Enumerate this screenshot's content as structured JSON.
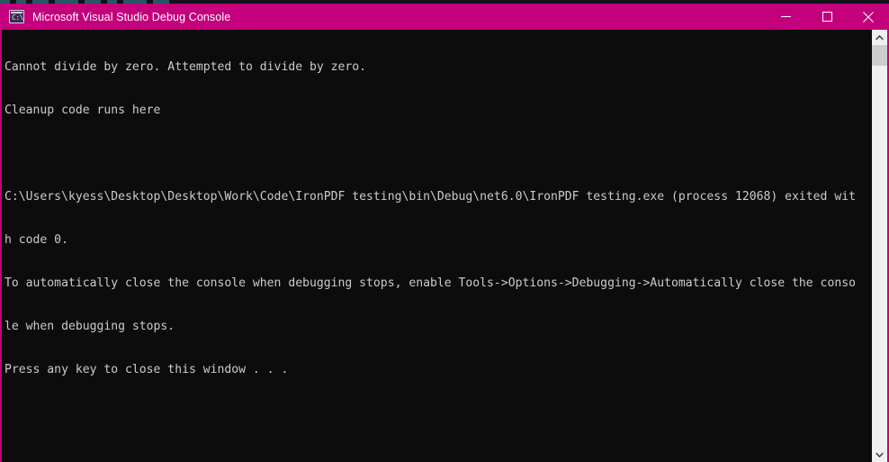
{
  "window": {
    "title": "Microsoft Visual Studio Debug Console",
    "icon": "console-window-icon",
    "icon_glyph": "C:\\",
    "titlebar_color": "#c5007c",
    "body_color": "#0c0c0c",
    "text_color": "#cccccc"
  },
  "titlebar_buttons": {
    "minimize": "minimize-icon",
    "maximize": "maximize-icon",
    "close": "close-icon"
  },
  "console": {
    "lines": [
      "Cannot divide by zero. Attempted to divide by zero.",
      "Cleanup code runs here",
      "",
      "C:\\Users\\kyess\\Desktop\\Desktop\\Work\\Code\\IronPDF testing\\bin\\Debug\\net6.0\\IronPDF testing.exe (process 12068) exited wit",
      "h code 0.",
      "To automatically close the console when debugging stops, enable Tools->Options->Debugging->Automatically close the conso",
      "le when debugging stops.",
      "Press any key to close this window . . ."
    ]
  },
  "scrollbar": {
    "up_arrow": "chevron-up-icon",
    "down_arrow": "chevron-down-icon",
    "thumb": "scrollbar-thumb"
  }
}
